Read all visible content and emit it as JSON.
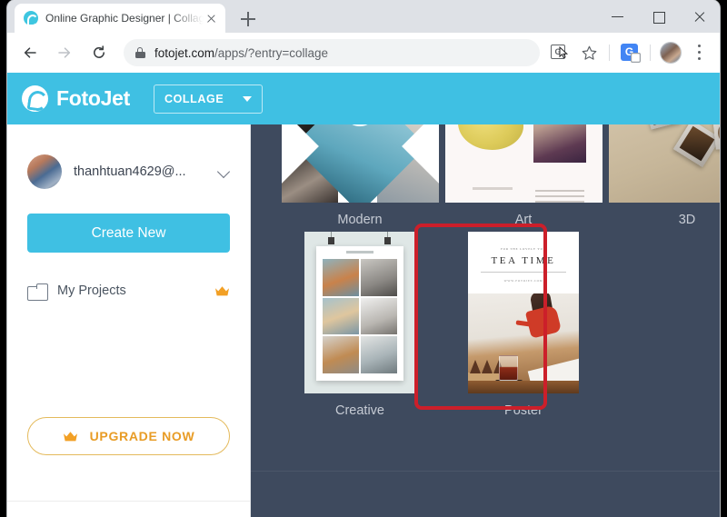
{
  "browser": {
    "tab": {
      "title": "Online Graphic Designer | Collage",
      "favicon_name": "fotojet-favicon",
      "close_label": "×"
    },
    "new_tab_label": "+",
    "window_controls": {
      "minimize": "–",
      "maximize": "□",
      "close": "×"
    },
    "toolbar": {
      "back_label": "Back",
      "forward_label": "Forward",
      "reload_label": "Reload",
      "url_secure": "fotojet.com",
      "url_path": "/apps/?entry=collage",
      "lock_icon": "lock-icon",
      "translate_icon": "translate-icon",
      "bookmark_icon": "star-icon",
      "google_translate_icon": "google-translate-extension-icon",
      "profile_icon": "avatar",
      "menu_icon": "three-dots-menu-icon",
      "translate_glyph": "G",
      "gtrans_glyph": "G"
    }
  },
  "app": {
    "brand": "FotoJet",
    "mode_button": {
      "label": "COLLAGE",
      "caret": "chevron-down-icon"
    }
  },
  "sidebar": {
    "account": {
      "name": "thanhtuan4629@...",
      "avatar_name": "account-avatar",
      "chevron": "chevron-down-icon"
    },
    "create_new_label": "Create New",
    "my_projects": {
      "label": "My Projects",
      "folder_icon": "folder-icon",
      "premium_badge": "crown-icon"
    },
    "upgrade": {
      "label": "UPGRADE NOW",
      "crown_icon": "crown-icon"
    }
  },
  "gallery": {
    "templates_row_top": [
      {
        "label": "Modern",
        "art": "modern"
      },
      {
        "label": "Art",
        "art": "art"
      },
      {
        "label": "3D",
        "art": "3d"
      }
    ],
    "templates_row_mid": [
      {
        "label": "Creative",
        "art": "creative"
      },
      {
        "label": "Poster",
        "art": "poster",
        "highlighted": true
      }
    ],
    "poster_preview": {
      "kicker": "FOR THE LOVELY YOU",
      "title": "TEA TIME",
      "site": "WWW.FOTOJET.COM"
    }
  },
  "annotation": {
    "color": "#cc1f2a",
    "target": "Poster"
  },
  "colors": {
    "brand": "#3fc0e3",
    "gallery_bg": "#3e4a5e",
    "upgrade": "#e89c26",
    "annotation": "#cc1f2a"
  }
}
